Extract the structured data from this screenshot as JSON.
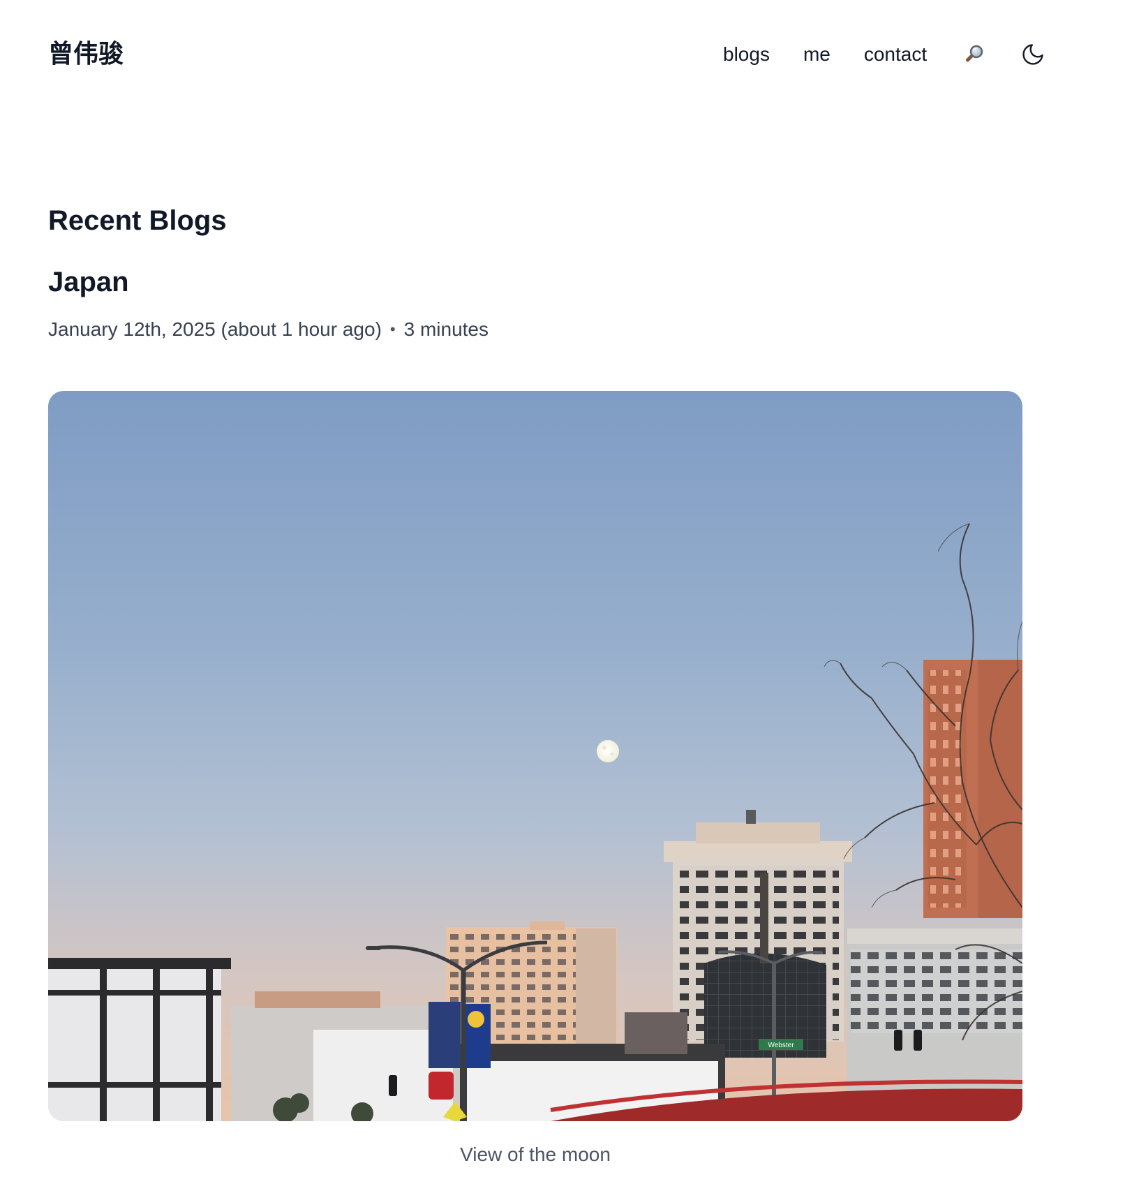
{
  "header": {
    "site_title": "曾伟骏",
    "nav": {
      "blogs": "blogs",
      "me": "me",
      "contact": "contact"
    },
    "icons": {
      "search": "magnifying-glass",
      "theme": "moon"
    }
  },
  "main": {
    "section_title": "Recent Blogs",
    "post": {
      "title": "Japan",
      "date": "January 12th, 2025 (about 1 hour ago)",
      "separator": "•",
      "reading_time": "3 minutes",
      "image_caption": "View of the moon",
      "sign_text": "Webster"
    }
  },
  "colors": {
    "text": "#111827",
    "meta": "#374151",
    "caption": "#4b5563",
    "sky_top": "#7f9cc4",
    "sky_bottom": "#e6c3ac"
  }
}
